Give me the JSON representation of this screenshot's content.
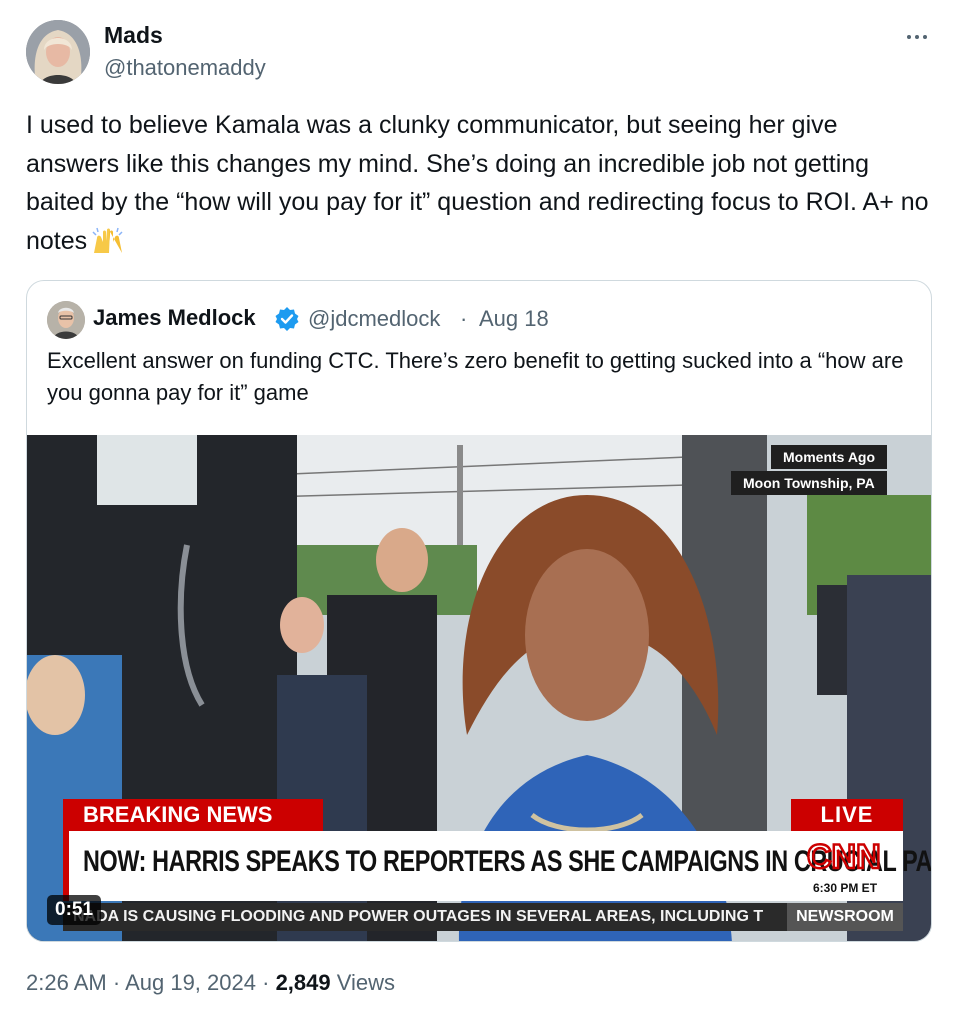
{
  "author": {
    "name": "Mads",
    "handle": "@thatonemaddy"
  },
  "tweet": {
    "text": "I used to believe Kamala was a clunky communicator, but seeing her give answers like this changes my mind. She’s doing an incredible job not getting baited by the “how will you pay for it” question and redirecting focus to ROI. A+ no notes",
    "emoji_icon": "raising-hands-emoji"
  },
  "quoted": {
    "name": "James Medlock",
    "handle": "@jdcmedlock",
    "separator": "·",
    "date": "Aug 18",
    "text": "Excellent answer on funding CTC. There’s zero benefit to getting sucked into a “how are you gonna pay for it” game",
    "verified_color": "#1d9bf0"
  },
  "video": {
    "tag_time": "Moments Ago",
    "tag_location": "Moon Township, PA",
    "breaking_label": "BREAKING NEWS",
    "live_label": "LIVE",
    "headline": "NOW: HARRIS SPEAKS TO REPORTERS AS SHE CAMPAIGNS IN CRUCIAL PA",
    "network": "CNN",
    "network_time": "6:30 PM ET",
    "ticker": "NADA IS CAUSING FLOODING AND POWER OUTAGES IN SEVERAL AREAS, INCLUDING T",
    "show": "NEWSROOM",
    "duration": "0:51",
    "accent_color": "#cc0000"
  },
  "meta": {
    "time": "2:26 AM",
    "sep1": "·",
    "date": "Aug 19, 2024",
    "sep2": "·",
    "views_count": "2,849",
    "views_label": "Views"
  }
}
